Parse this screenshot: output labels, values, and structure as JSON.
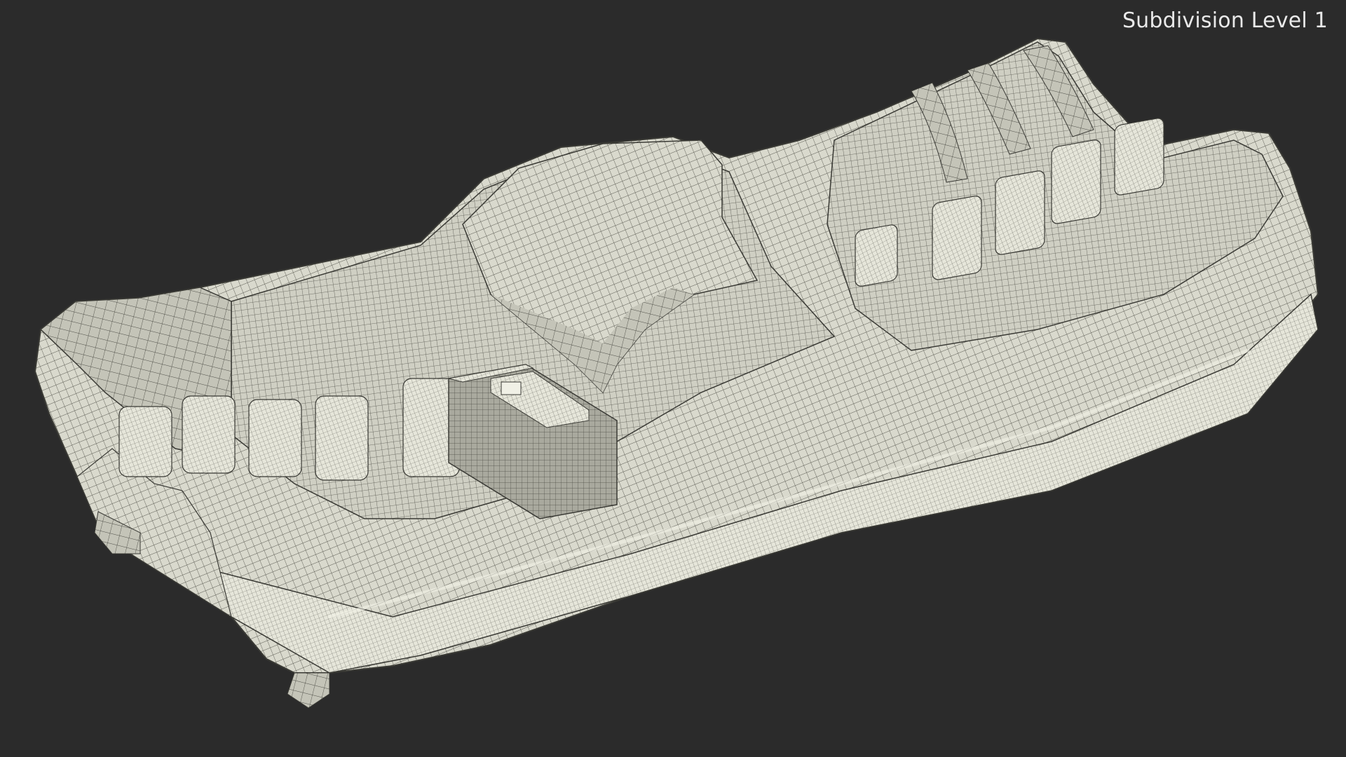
{
  "viewport": {
    "label": "Subdivision Level 1",
    "background_color": "#2b2b2b",
    "label_color": "#e9e9e9"
  },
  "model": {
    "mesh_fill_color": "#d8d8cc",
    "wire_color": "#4a4a44",
    "shadow_color": "#8e8e84"
  }
}
